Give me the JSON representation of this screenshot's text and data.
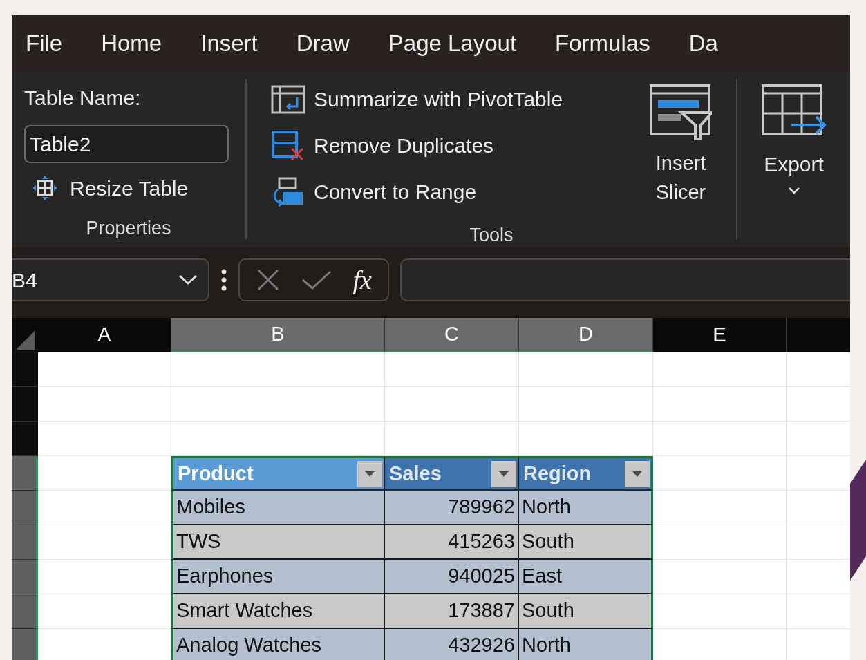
{
  "menu": [
    {
      "label": "File"
    },
    {
      "label": "Home"
    },
    {
      "label": "Insert"
    },
    {
      "label": "Draw"
    },
    {
      "label": "Page Layout"
    },
    {
      "label": "Formulas"
    },
    {
      "label": "Da"
    }
  ],
  "ribbon": {
    "properties": {
      "table_name_label": "Table Name:",
      "table_name": "Table2",
      "resize_button": "Resize Table",
      "group_label": "Properties"
    },
    "tools": {
      "buttons": [
        {
          "kind": "pivot",
          "label": "Summarize with PivotTable"
        },
        {
          "kind": "duplicates",
          "label": "Remove Duplicates"
        },
        {
          "kind": "range",
          "label": "Convert to Range"
        }
      ],
      "slicer": "Insert Slicer",
      "group_label": "Tools"
    },
    "export": {
      "label": "Export"
    }
  },
  "formula_bar": {
    "name_box": "B4",
    "fx": "fx"
  },
  "columns": [
    {
      "label": "A",
      "selected": false
    },
    {
      "label": "B",
      "selected": true
    },
    {
      "label": "C",
      "selected": true
    },
    {
      "label": "D",
      "selected": true
    },
    {
      "label": "E",
      "selected": false
    }
  ],
  "rows": [
    {
      "selected": false
    },
    {
      "selected": false
    },
    {
      "selected": false
    },
    {
      "selected": true
    },
    {
      "selected": true
    },
    {
      "selected": true
    },
    {
      "selected": true
    },
    {
      "selected": true
    },
    {
      "selected": true
    }
  ],
  "table": {
    "columns": [
      {
        "label": "Product",
        "selected": true
      },
      {
        "label": "Sales",
        "selected": false
      },
      {
        "label": "Region",
        "selected": false
      }
    ],
    "rows": [
      [
        "Mobiles",
        "789962",
        "North"
      ],
      [
        "TWS",
        "415263",
        "South"
      ],
      [
        "Earphones",
        "940025",
        "East"
      ],
      [
        "Smart Watches",
        "173887",
        "South"
      ],
      [
        "Analog Watches",
        "432926",
        "North"
      ]
    ]
  }
}
